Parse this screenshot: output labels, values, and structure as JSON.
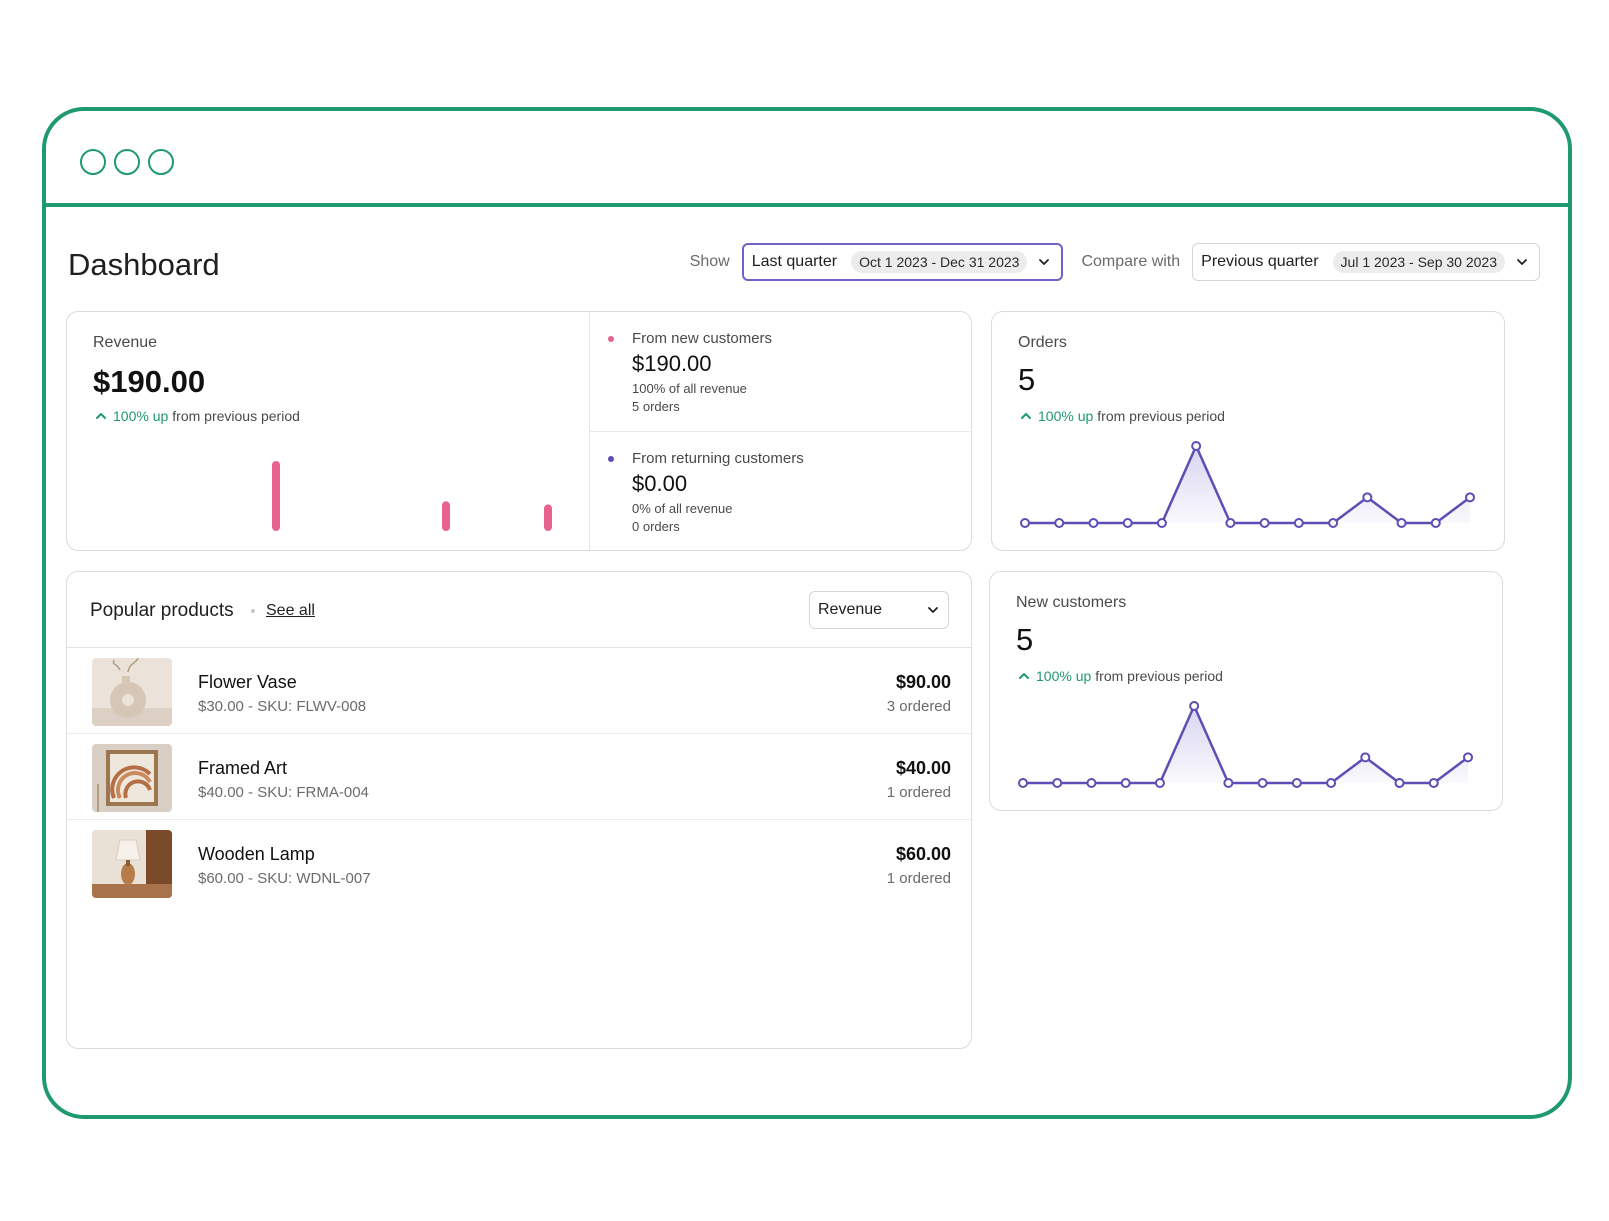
{
  "header": {
    "title": "Dashboard",
    "show_label": "Show",
    "show_value": "Last quarter",
    "show_range": "Oct 1 2023 - Dec 31 2023",
    "compare_label": "Compare with",
    "compare_value": "Previous quarter",
    "compare_range": "Jul 1 2023 - Sep 30 2023"
  },
  "revenue": {
    "label": "Revenue",
    "value": "$190.00",
    "trend_up": "100% up",
    "trend_rest": "from previous period",
    "bars": [
      1.0,
      0.35,
      0.3
    ],
    "new_customers": {
      "label": "From new customers",
      "value": "$190.00",
      "share": "100% of all revenue",
      "orders": "5 orders"
    },
    "returning_customers": {
      "label": "From returning customers",
      "value": "$0.00",
      "share": "0% of all revenue",
      "orders": "0 orders"
    }
  },
  "orders": {
    "label": "Orders",
    "value": "5",
    "trend_up": "100% up",
    "trend_rest": "from previous period"
  },
  "new_customers_card": {
    "label": "New customers",
    "value": "5",
    "trend_up": "100% up",
    "trend_rest": "from previous period"
  },
  "products": {
    "title": "Popular products",
    "see_all": "See all",
    "sort_value": "Revenue",
    "items": [
      {
        "name": "Flower Vase",
        "meta": "$30.00 - SKU: FLWV-008",
        "price": "$90.00",
        "ordered": "3 ordered"
      },
      {
        "name": "Framed Art",
        "meta": "$40.00 - SKU: FRMA-004",
        "price": "$40.00",
        "ordered": "1 ordered"
      },
      {
        "name": "Wooden Lamp",
        "meta": "$60.00 - SKU: WDNL-007",
        "price": "$60.00",
        "ordered": "1 ordered"
      }
    ]
  },
  "colors": {
    "accent": "#1f9a6e",
    "line": "#5b4fb5",
    "bar": "#e8628f"
  },
  "chart_data": [
    {
      "type": "line",
      "values": [
        0,
        0,
        0,
        0,
        0,
        3,
        0,
        0,
        0,
        0,
        1,
        0,
        0,
        1
      ]
    },
    {
      "type": "line",
      "values": [
        0,
        0,
        0,
        0,
        0,
        3,
        0,
        0,
        0,
        0,
        1,
        0,
        0,
        1
      ]
    }
  ]
}
